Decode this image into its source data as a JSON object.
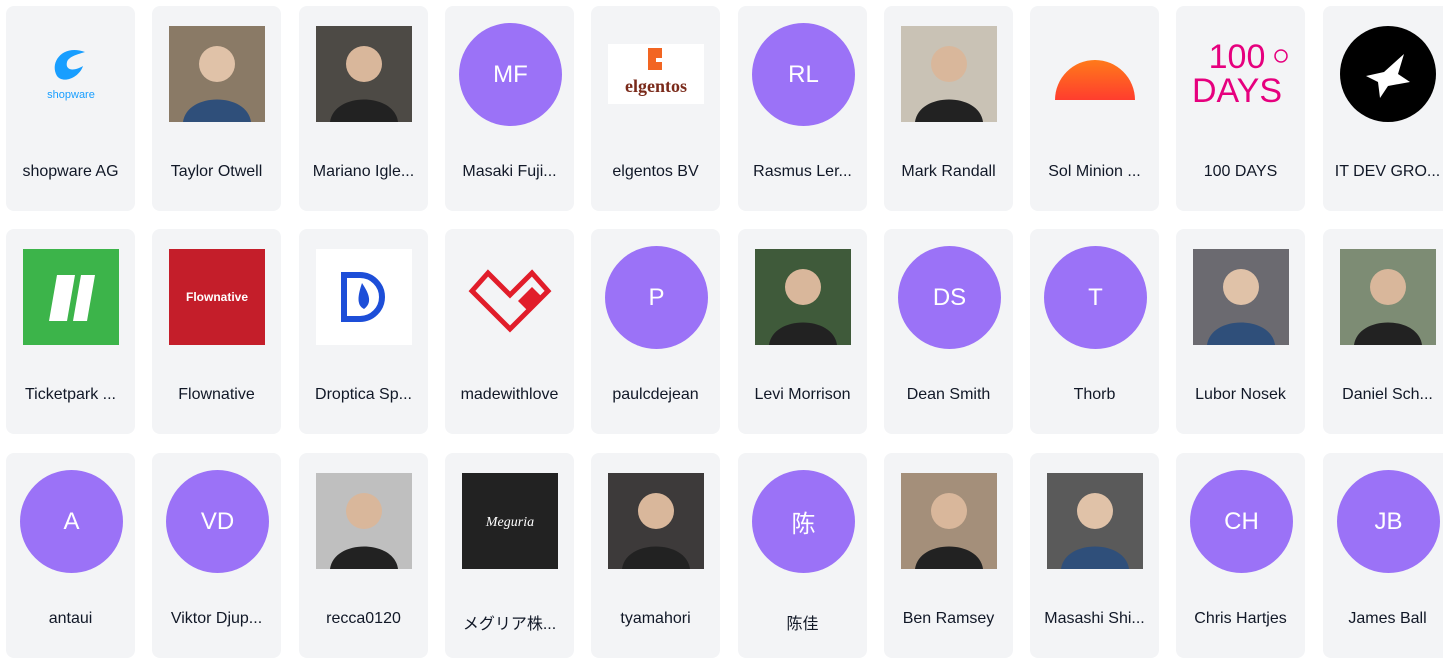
{
  "colors": {
    "card_bg": "#f3f4f6",
    "avatar_purple": "#9b72f7",
    "text": "#111827"
  },
  "sponsors": [
    [
      {
        "name": "shopware AG",
        "avatar": {
          "type": "logo",
          "icon": "shopware-logo-icon",
          "text": "shopware"
        }
      },
      {
        "name": "Taylor Otwell",
        "avatar": {
          "type": "photo",
          "icon": "photo-avatar-icon"
        }
      },
      {
        "name": "Mariano Igle...",
        "avatar": {
          "type": "photo",
          "icon": "photo-avatar-icon"
        }
      },
      {
        "name": "Masaki Fuji...",
        "avatar": {
          "type": "initials",
          "text": "MF"
        }
      },
      {
        "name": "elgentos BV",
        "avatar": {
          "type": "logo",
          "icon": "elgentos-logo-icon",
          "text": "elgentos"
        }
      },
      {
        "name": "Rasmus Ler...",
        "avatar": {
          "type": "initials",
          "text": "RL"
        }
      },
      {
        "name": "Mark Randall",
        "avatar": {
          "type": "photo",
          "icon": "photo-avatar-icon"
        }
      },
      {
        "name": "Sol Minion ...",
        "avatar": {
          "type": "logo",
          "icon": "sunrise-logo-icon"
        }
      },
      {
        "name": "100 DAYS",
        "avatar": {
          "type": "logo",
          "icon": "100-days-logo-icon",
          "text": "100\nDAYS"
        }
      },
      {
        "name": "IT DEV GRO...",
        "avatar": {
          "type": "logo",
          "icon": "bird-logo-icon"
        }
      }
    ],
    [
      {
        "name": "Ticketpark ...",
        "avatar": {
          "type": "logo",
          "icon": "ticketpark-logo-icon"
        }
      },
      {
        "name": "Flownative",
        "avatar": {
          "type": "logo",
          "icon": "flownative-logo-icon",
          "text": "Flownative"
        }
      },
      {
        "name": "Droptica Sp...",
        "avatar": {
          "type": "logo",
          "icon": "droptica-logo-icon"
        }
      },
      {
        "name": "madewithlove",
        "avatar": {
          "type": "logo",
          "icon": "heart-logo-icon"
        }
      },
      {
        "name": "paulcdejean",
        "avatar": {
          "type": "initials",
          "text": "P"
        }
      },
      {
        "name": "Levi Morrison",
        "avatar": {
          "type": "photo",
          "icon": "photo-avatar-icon"
        }
      },
      {
        "name": "Dean Smith",
        "avatar": {
          "type": "initials",
          "text": "DS"
        }
      },
      {
        "name": "Thorb",
        "avatar": {
          "type": "initials",
          "text": "T"
        }
      },
      {
        "name": "Lubor Nosek",
        "avatar": {
          "type": "photo",
          "icon": "photo-avatar-icon"
        }
      },
      {
        "name": "Daniel Sch...",
        "avatar": {
          "type": "photo",
          "icon": "photo-avatar-icon"
        }
      }
    ],
    [
      {
        "name": "antaui",
        "avatar": {
          "type": "initials",
          "text": "A"
        }
      },
      {
        "name": "Viktor Djup...",
        "avatar": {
          "type": "initials",
          "text": "VD"
        }
      },
      {
        "name": "recca0120",
        "avatar": {
          "type": "photo",
          "icon": "cartoon-avatar-icon"
        }
      },
      {
        "name": "メグリア株...",
        "avatar": {
          "type": "logo",
          "icon": "meguria-logo-icon",
          "text": "Meguria"
        }
      },
      {
        "name": "tyamahori",
        "avatar": {
          "type": "photo",
          "icon": "photo-avatar-icon"
        }
      },
      {
        "name": "陈佳",
        "avatar": {
          "type": "initials",
          "text": "陈"
        }
      },
      {
        "name": "Ben Ramsey",
        "avatar": {
          "type": "photo",
          "icon": "photo-avatar-icon"
        }
      },
      {
        "name": "Masashi Shi...",
        "avatar": {
          "type": "photo",
          "icon": "photo-avatar-icon"
        }
      },
      {
        "name": "Chris Hartjes",
        "avatar": {
          "type": "initials",
          "text": "CH"
        }
      },
      {
        "name": "James Ball",
        "avatar": {
          "type": "initials",
          "text": "JB"
        }
      }
    ]
  ]
}
